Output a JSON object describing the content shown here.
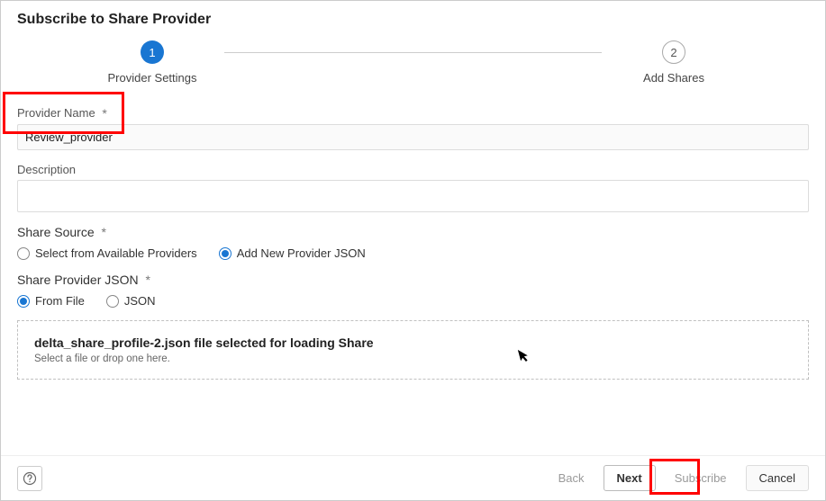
{
  "dialog": {
    "title": "Subscribe to Share Provider"
  },
  "stepper": {
    "step1_num": "1",
    "step1_label": "Provider Settings",
    "step2_num": "2",
    "step2_label": "Add Shares"
  },
  "provider_name": {
    "label": "Provider Name",
    "required_mark": "*",
    "value": "Review_provider"
  },
  "description": {
    "label": "Description",
    "value": ""
  },
  "share_source": {
    "label": "Share Source",
    "required_mark": "*",
    "option_available": "Select from Available Providers",
    "option_new": "Add New Provider JSON"
  },
  "share_json": {
    "label": "Share Provider JSON",
    "required_mark": "*",
    "option_file": "From File",
    "option_json": "JSON"
  },
  "dropzone": {
    "title": "delta_share_profile-2.json file selected for loading Share",
    "subtitle": "Select a file or drop one here."
  },
  "footer": {
    "help_tooltip": "Help",
    "back": "Back",
    "next": "Next",
    "subscribe": "Subscribe",
    "cancel": "Cancel"
  }
}
